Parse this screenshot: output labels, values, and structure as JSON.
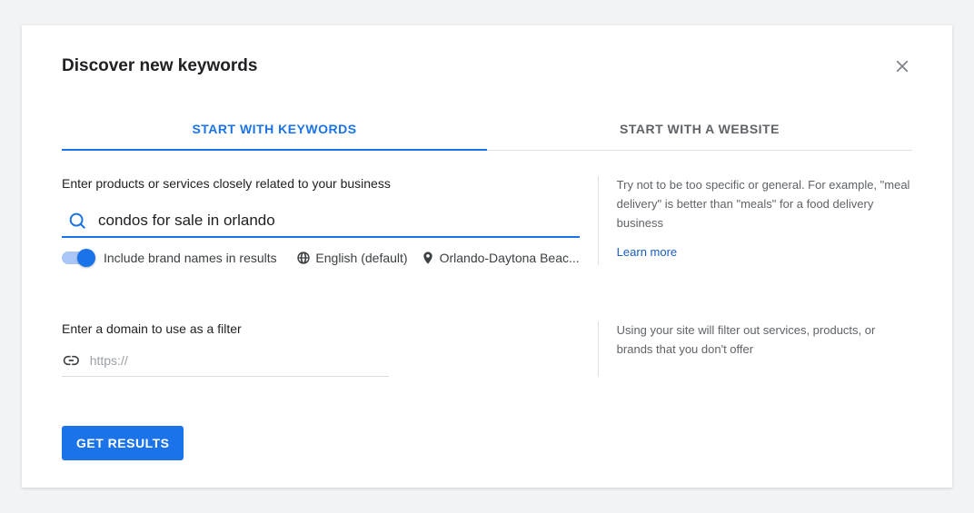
{
  "title": "Discover new keywords",
  "tabs": {
    "keywords": "START WITH KEYWORDS",
    "website": "START WITH A WEBSITE"
  },
  "main": {
    "label": "Enter products or services closely related to your business",
    "input_value": "condos for sale in orlando",
    "toggle_label": "Include brand names in results",
    "language": "English (default)",
    "location": "Orlando-Daytona Beac...",
    "hint": "Try not to be too specific or general. For example, \"meal delivery\" is better than \"meals\" for a food delivery business",
    "learn_more": "Learn more"
  },
  "domain": {
    "label": "Enter a domain to use as a filter",
    "placeholder": "https://",
    "hint": "Using your site will filter out services, products, or brands that you don't offer"
  },
  "cta": "GET RESULTS"
}
